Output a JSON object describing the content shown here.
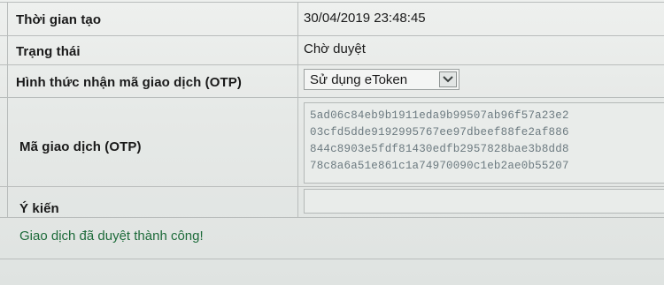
{
  "rows": {
    "created_time": {
      "label": "Thời gian tạo",
      "value": "30/04/2019 23:48:45"
    },
    "status": {
      "label": "Trạng thái",
      "value": "Chờ duyệt"
    },
    "otp_method": {
      "label": "Hình thức nhận mã giao dịch (OTP)",
      "selected": "Sử dụng eToken"
    },
    "otp_code": {
      "label": "Mã giao dịch (OTP)",
      "lines": [
        "5ad06c84eb9b1911eda9b99507ab96f57a23e2",
        "03cfd5dde9192995767ee97dbeef88fe2af886",
        "844c8903e5fdf81430edfb2957828bae3b8dd8",
        "78c8a6a51e861c1a74970090c1eb2ae0b55207"
      ]
    },
    "comment": {
      "label": "Ý kiến",
      "value": ""
    }
  },
  "message": "Giao dịch đã duyệt thành công!",
  "icons": {
    "dropdown": "chevron-down-icon"
  },
  "colors": {
    "success_text": "#1d6b3a",
    "otp_text": "#6c7a80"
  }
}
